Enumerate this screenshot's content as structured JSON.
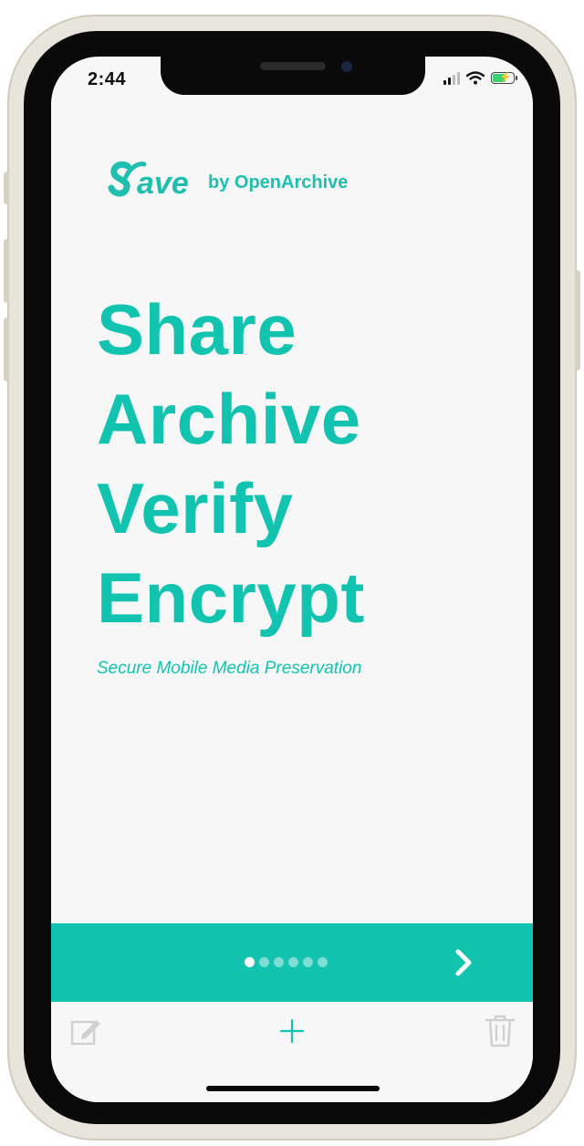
{
  "status_bar": {
    "time": "2:44",
    "icons": [
      "cellular-signal-icon",
      "wifi-icon",
      "battery-charging-icon"
    ]
  },
  "header": {
    "logo_text": "Save",
    "byline": "by OpenArchive"
  },
  "hero": {
    "words": [
      "Share",
      "Archive",
      "Verify",
      "Encrypt"
    ],
    "tagline": "Secure Mobile Media Preservation"
  },
  "pager": {
    "page_count": 6,
    "current_page": 1,
    "next_icon": "chevron-right-icon"
  },
  "toolbar": {
    "edit_icon": "edit-icon",
    "add_icon": "plus-icon",
    "delete_icon": "trash-icon"
  },
  "colors": {
    "accent": "#12c4b0",
    "screen_background": "#f7f7f7",
    "toolbar_icon_disabled": "#d0d0d0",
    "toolbar_icon_active": "#12c4b0"
  }
}
